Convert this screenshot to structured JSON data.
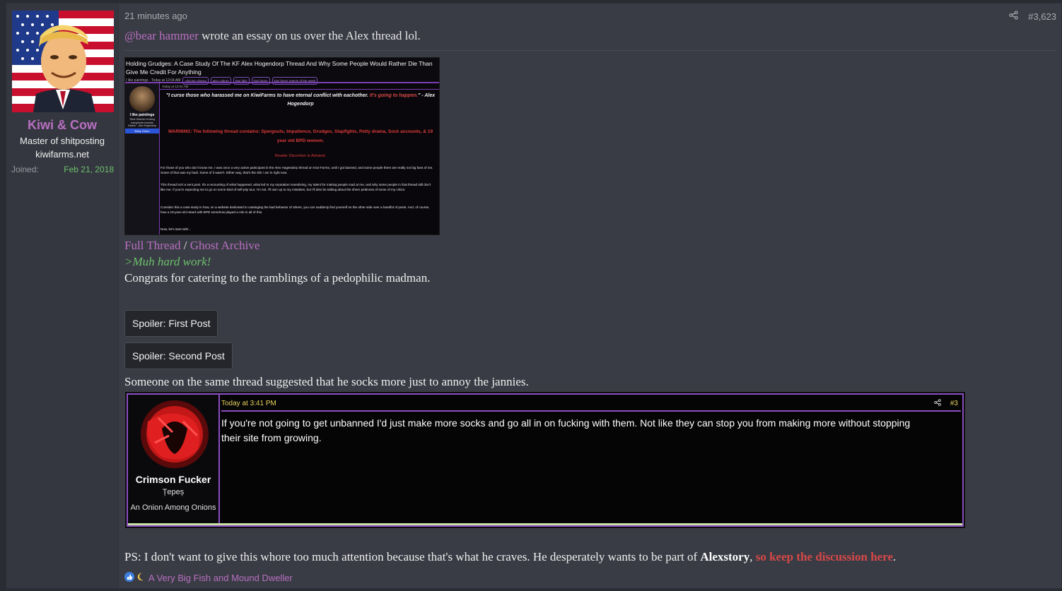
{
  "user": {
    "name": "Kiwi & Cow",
    "title": "Master of shitposting",
    "site": "kiwifarms.net",
    "joined_label": "Joined:",
    "joined_value": "Feb 21, 2018"
  },
  "post": {
    "time": "21 minutes ago",
    "number": "#3,623",
    "mention": "@bear hammer",
    "intro": " wrote an essay on us over the Alex thread lol.",
    "full_thread": "Full Thread",
    "separator": " / ",
    "ghost_archive": "Ghost Archive",
    "greentext": ">Muh hard work!",
    "congrats": "Congrats for catering to the ramblings of a pedophilic madman.",
    "spoiler1": "Spoiler: First Post",
    "spoiler2": "Spoiler: Second Post",
    "someone": "Someone on the same thread suggested that he socks more just to annoy the jannies.",
    "ps_before": "PS: I don't want to give this whore too much attention because that's what he craves. He desperately wants to be part of ",
    "ps_bold": "Alexstory",
    "ps_comma": ", ",
    "ps_link": "so keep the discussion here",
    "ps_end": ".",
    "reactions": "A Very Big Fish and Mound Dweller"
  },
  "embedded_image": {
    "title": "Holding Grudges: A Case Study Of The KF Alex Hogendorp Thread And Why Some People Would Rather Die Than Give Me Credit For Anything",
    "byline": "I like paintings · Today at 12:04 AM",
    "tags": [
      "criticism drama",
      "alex culture",
      "kiwi fails",
      "kiwi farms",
      "kiwi farms rejects of the week"
    ],
    "inner_time": "Today at 12:04 AM",
    "side_name": "I like paintings",
    "side_quote": "\"Bear Hammer is being transphobic towards Xalaen\" - Alex Hogendorp",
    "side_badge": "Baby Onion",
    "quote": "\"I curse those who harassed me on KiwiFarms to have eternal conflict with eachother.",
    "quote_red": "It's going to happen.",
    "quote_end": "\" - Alex Hogendorp",
    "warning": "WARNING: The following thread contains: Spergouts, Impatience, Grudges, Slapfights, Petty drama, Sock accounts, & 19 year old BPD women.",
    "discretion": "Reader Discretion Is Advised.",
    "p1": "For those of you who don't know me, I was once a very active participant in the Alex Hogendorp thread on Kiwi Farms, until I got banned, and some people there are really not big fans of me. Some of that was my fault. Some of it wasn't. Either way, that's the shit I am in right now.",
    "p2": "This thread isn't a vent post. It's a recounting of what happened, what led to my reputation nosediving, my talent for making people mad at me, and why some people in that thread still don't like me. If you're expecting me to go on some kind of self-pity tour, I'm not. I'll own up to my mistakes, but I'll also be talking about the sheer pettiness of some of my critics.",
    "p3": "Consider this a case study in how, on a website dedicated to cataloging the bad behavior of others, you can suddenly find yourself on the other side over a handful of posts. And, of course, how a 19-year-old retard with BPD somehow played a role in all of this.",
    "p4": "Now, let's start with..."
  },
  "quoted_post": {
    "time": "Today at 3:41 PM",
    "number": "#3",
    "name": "Crimson Fucker",
    "title": "Țepeș",
    "rank": "An Onion Among Onions",
    "text": "If you're not going to get unbanned I'd just make more socks and go all in on fucking with them. Not like they can stop you from making more without stopping their site from growing."
  },
  "colors": {
    "accent": "#b86fc1",
    "green": "#6cc16b",
    "red": "#d64848",
    "background": "#3a3c45"
  },
  "icons": {
    "share": "share-icon",
    "like": "like-reaction-icon",
    "moon": "moon-reaction-icon"
  }
}
